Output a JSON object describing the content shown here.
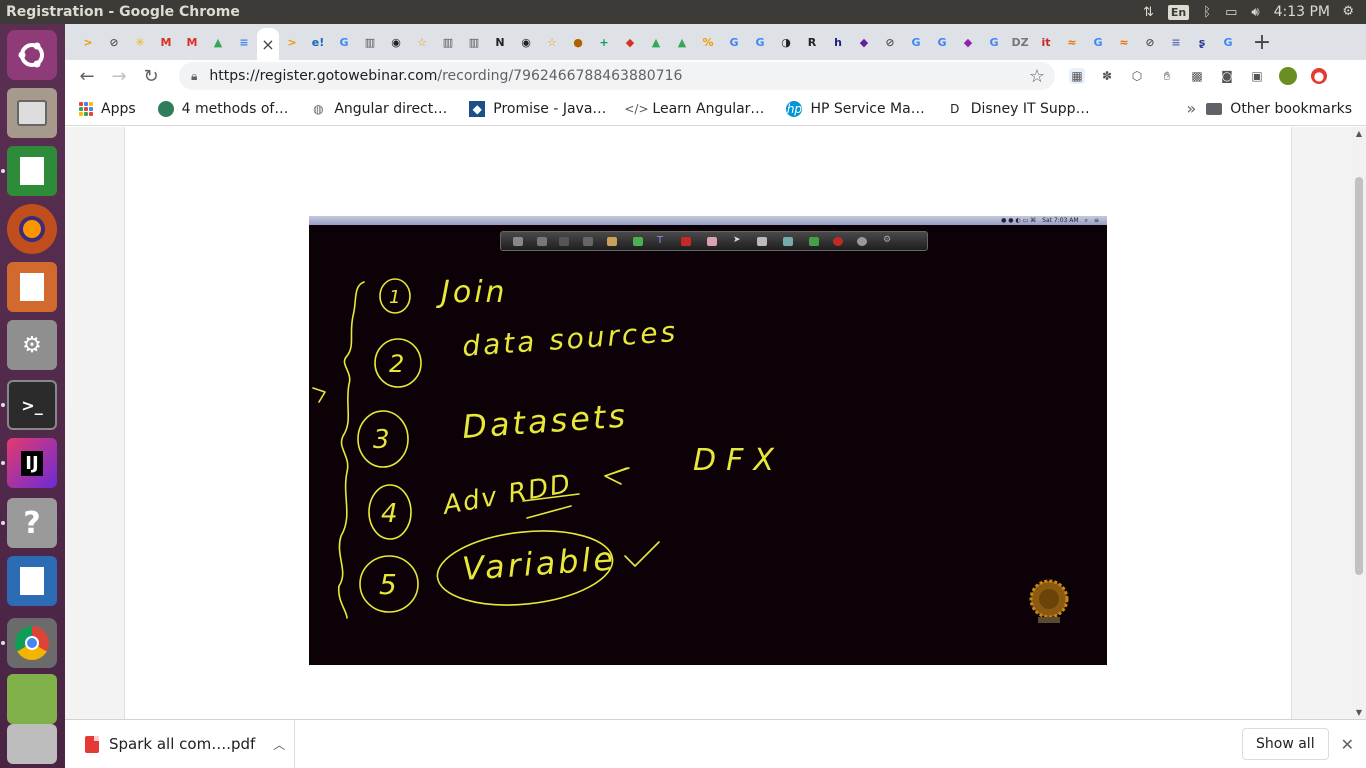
{
  "window": {
    "title": "Registration - Google Chrome",
    "clock": "4:13 PM",
    "keyboard_layout": "En"
  },
  "launcher": {
    "items": [
      "ubuntu-dash",
      "files",
      "libreoffice-calc",
      "firefox",
      "libreoffice-impress",
      "system-settings",
      "terminal",
      "intellij-idea",
      "help",
      "libreoffice-writer",
      "google-chrome",
      "spreadsheet-app",
      "disks"
    ]
  },
  "tabs": {
    "favicons": [
      ">",
      "⊘",
      "✳",
      "M",
      "M",
      "▲",
      "≡",
      "×",
      ">",
      "e!",
      "G",
      "▥",
      "◉",
      "☆",
      "▥",
      "▥",
      "N",
      "◉",
      "☆",
      "●",
      "+",
      "◆",
      "▲",
      "▲",
      "%",
      "G",
      "G",
      "◑",
      "R",
      "h",
      "◆",
      "⊘",
      "G",
      "G",
      "◆",
      "G",
      "DZ",
      "it",
      "≈",
      "G",
      "≈",
      "⊘",
      "≡",
      "ʂ",
      "G"
    ],
    "new_tab": "+"
  },
  "toolbar": {
    "url_host": "https://register.gotowebinar.com",
    "url_path": "/recording/7962466788463880716"
  },
  "bookmarks": {
    "apps_label": "Apps",
    "items": [
      {
        "label": "4 methods of…",
        "icon": "avatar-icon"
      },
      {
        "label": "Angular direct…",
        "icon": "globe-icon"
      },
      {
        "label": "Promise - Java…",
        "icon": "mdn-icon"
      },
      {
        "label": "Learn Angular…",
        "icon": "code-icon"
      },
      {
        "label": "HP Service Ma…",
        "icon": "hp-icon"
      },
      {
        "label": "Disney IT Supp…",
        "icon": "disney-icon"
      }
    ],
    "more": "»",
    "other_label": "Other bookmarks"
  },
  "video": {
    "mac_menu_clock": "Sat 7:03 AM",
    "handwriting": {
      "items": [
        {
          "number": "1",
          "text": "Join"
        },
        {
          "number": "2",
          "text": "data  sources"
        },
        {
          "number": "3",
          "text": "Datasets"
        },
        {
          "number": "4",
          "text": "Adv RDD"
        },
        {
          "number": "5",
          "text": "Variable"
        }
      ],
      "side_note": "DFX"
    }
  },
  "downloads": {
    "file_name": "Spark all com….pdf",
    "show_all": "Show all"
  }
}
